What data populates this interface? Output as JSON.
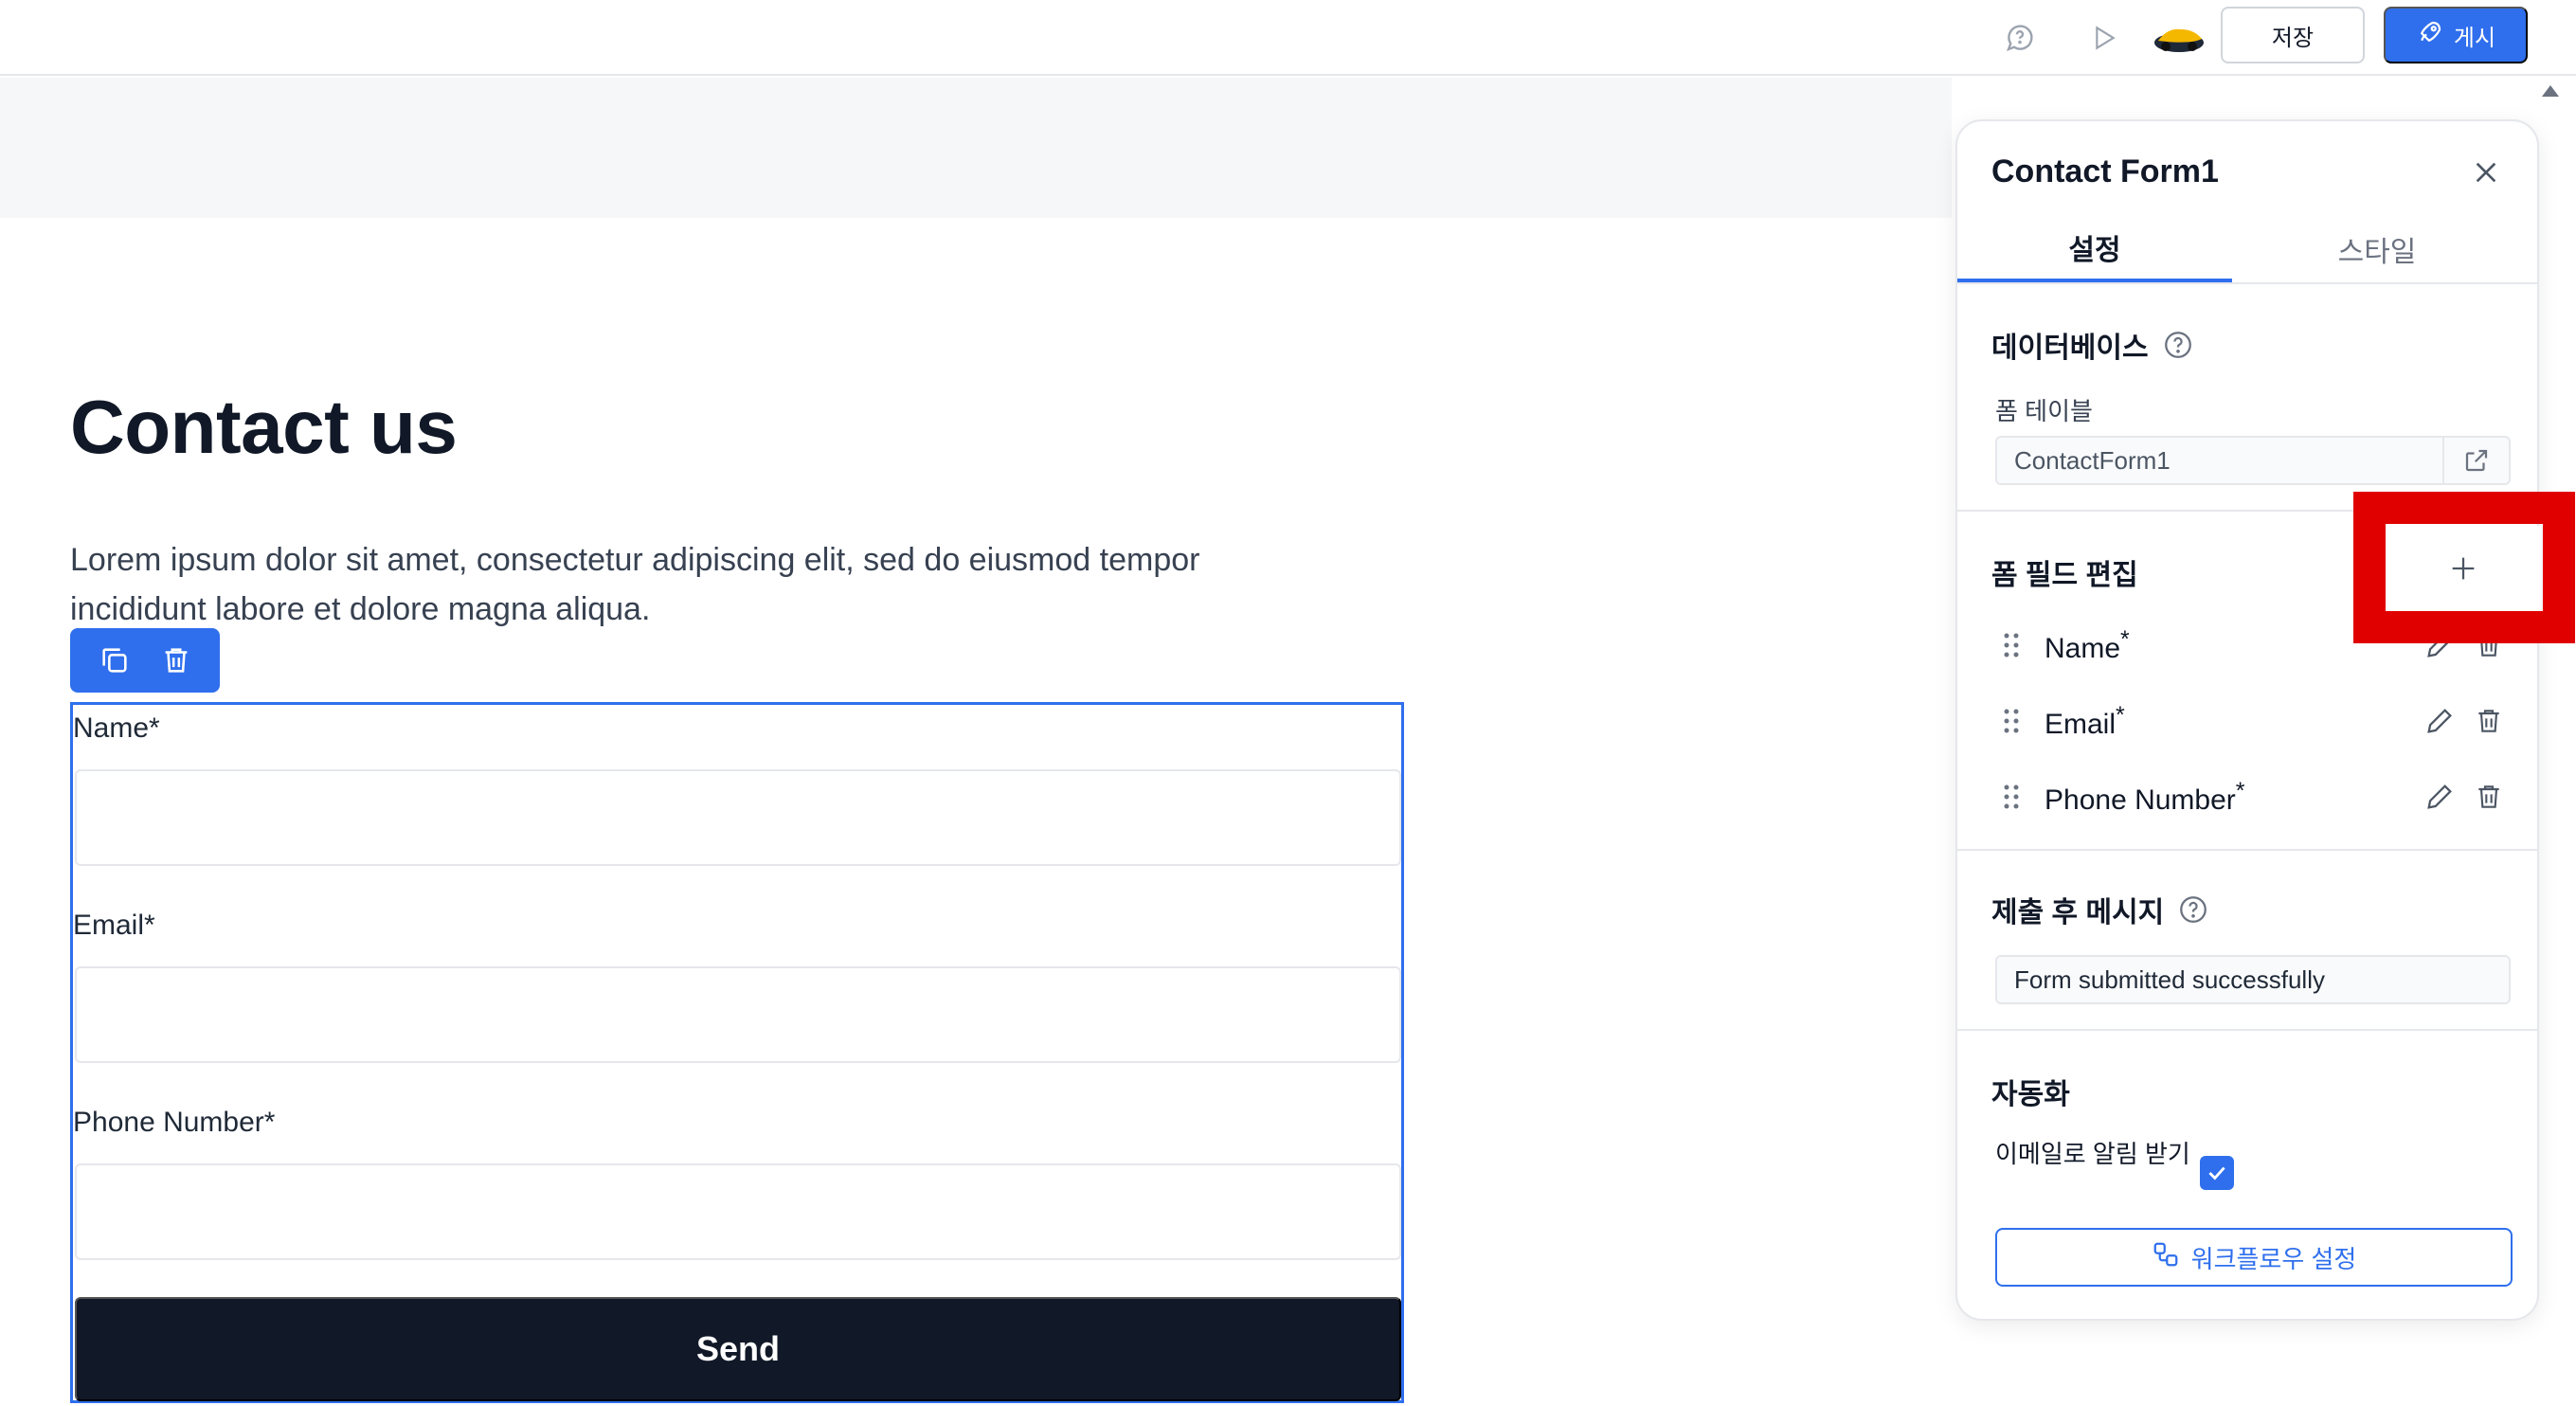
{
  "topbar": {
    "save_label": "저장",
    "publish_label": "게시"
  },
  "page": {
    "title": "Contact us",
    "description": "Lorem ipsum dolor sit amet, consectetur adipiscing elit, sed do eiusmod tempor incididunt labore et dolore magna aliqua."
  },
  "form": {
    "fields": [
      {
        "label": "Name*"
      },
      {
        "label": "Email*"
      },
      {
        "label": "Phone Number*"
      }
    ],
    "submit_label": "Send"
  },
  "panel": {
    "title": "Contact Form1",
    "tabs": [
      {
        "label": "설정"
      },
      {
        "label": "스타일"
      }
    ],
    "database": {
      "title": "데이터베이스",
      "table_label": "폼 테이블",
      "table_value": "ContactForm1"
    },
    "field_edit": {
      "title": "폼 필드 편집",
      "items": [
        {
          "label": "Name",
          "required": "*"
        },
        {
          "label": "Email",
          "required": "*"
        },
        {
          "label": "Phone Number",
          "required": "*"
        }
      ]
    },
    "after_submit": {
      "title": "제출 후 메시지",
      "value": "Form submitted successfully"
    },
    "automation": {
      "title": "자동화",
      "notify_label": "이메일로 알림 받기",
      "notify_checked": true,
      "workflow_label": "워크플로우 설정"
    }
  },
  "colors": {
    "accent": "#2f6fed",
    "highlight": "#e00000",
    "dark_button": "#111827"
  }
}
